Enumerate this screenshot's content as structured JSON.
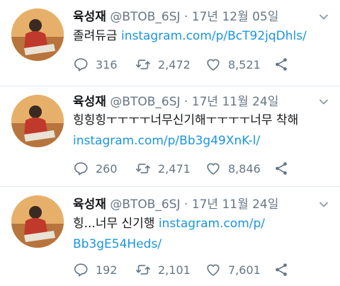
{
  "tweets": [
    {
      "name": "육성재",
      "handle": "@BTOB_6SJ",
      "separator": "·",
      "date": "17년 12월 05일",
      "line1_text": "졸려듀금 ",
      "line1_link": "instagram.com/p/BcT92jqDhls/",
      "line2_text": "",
      "line2_link": "",
      "replies": "316",
      "retweets": "2,472",
      "likes": "8,521"
    },
    {
      "name": "육성재",
      "handle": "@BTOB_6SJ",
      "separator": "·",
      "date": "17년 11월 24일",
      "line1_text": "힝힝힝ㅜㅜㅜㅜ너무신기해ㅜㅜㅜㅜ너무 착해",
      "line1_link": "",
      "line2_text": "",
      "line2_link": "instagram.com/p/Bb3g49XnK-l/",
      "replies": "260",
      "retweets": "2,471",
      "likes": "8,846"
    },
    {
      "name": "육성재",
      "handle": "@BTOB_6SJ",
      "separator": "·",
      "date": "17년 11월 24일",
      "line1_text": "힝...너무 신기행 ",
      "line1_link": "instagram.com/p/",
      "line2_text": "",
      "line2_link": "Bb3gE54Heds/",
      "replies": "192",
      "retweets": "2,101",
      "likes": "7,601"
    }
  ],
  "icons": {
    "reply": "reply-icon",
    "retweet": "retweet-icon",
    "like": "heart-icon",
    "share": "share-icon",
    "caret": "chevron-down-icon"
  },
  "colors": {
    "link": "#1b95e0",
    "secondary_text": "#657786",
    "divider": "#e1e8ed"
  }
}
